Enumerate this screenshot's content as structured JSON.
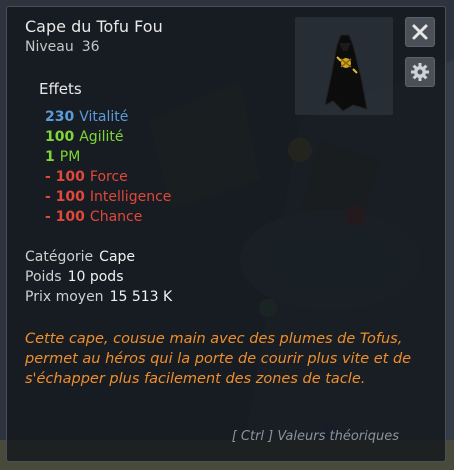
{
  "item": {
    "name": "Cape du Tofu Fou",
    "level_label": "Niveau",
    "level_value": "36"
  },
  "effects": {
    "section_title": "Effets",
    "list": [
      {
        "value": "230",
        "label": "Vitalité",
        "color": "#5b9bd8"
      },
      {
        "value": "100",
        "label": "Agilité",
        "color": "#7fd636"
      },
      {
        "value": "1",
        "label": "PM",
        "color": "#7fd636"
      },
      {
        "value": "- 100",
        "label": "Force",
        "color": "#e0483a"
      },
      {
        "value": "- 100",
        "label": "Intelligence",
        "color": "#e0483a"
      },
      {
        "value": "- 100",
        "label": "Chance",
        "color": "#e0483a"
      }
    ]
  },
  "details": {
    "category_label": "Catégorie",
    "category_value": "Cape",
    "weight_label": "Poids",
    "weight_value": "10 pods",
    "price_label": "Prix moyen",
    "price_value": "15 513 K"
  },
  "description": "Cette cape, cousue main avec des plumes de Tofus, permet au héros qui la porte de courir plus vite et de s'échapper plus facilement des zones de tacle.",
  "hint": "[ Ctrl ] Valeurs théoriques",
  "icons": {
    "close": "close-icon",
    "settings": "gear-icon",
    "item": "cape-icon"
  },
  "colors": {
    "description": "#ee8e2d",
    "positive": "#7fd636",
    "vitality": "#5b9bd8",
    "negative": "#e0483a"
  }
}
